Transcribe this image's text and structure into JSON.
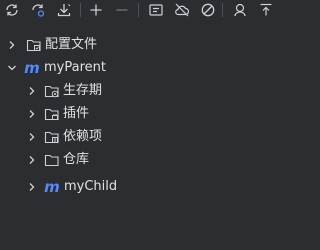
{
  "toolbar": {
    "buttons": [
      {
        "name": "reload-icon"
      },
      {
        "name": "reload-settings-icon"
      },
      {
        "name": "download-icon"
      },
      {
        "name": "add-icon"
      },
      {
        "name": "remove-icon"
      },
      {
        "name": "run-icon"
      },
      {
        "name": "offline-icon"
      },
      {
        "name": "skip-tests-icon"
      },
      {
        "name": "show-dependencies-icon"
      },
      {
        "name": "collapse-icon"
      }
    ]
  },
  "tree": {
    "config_files": "配置文件",
    "project": "myParent",
    "lifecycle": "生存期",
    "plugins": "插件",
    "dependencies": "依赖项",
    "repositories": "仓库",
    "child_module": "myChild",
    "module_glyph": "m"
  },
  "colors": {
    "background": "#2b2d30",
    "text": "#dfe1e5",
    "icon": "#ced0d6",
    "maven_blue": "#548af7"
  }
}
